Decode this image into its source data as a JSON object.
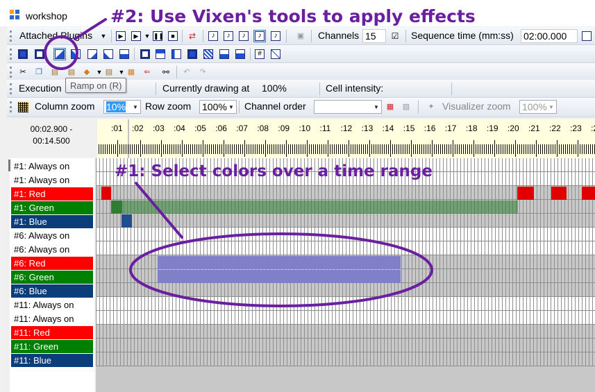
{
  "window": {
    "title": "workshop"
  },
  "toolbar1": {
    "attached_plugins_label": "Attached Plugins",
    "channels_label": "Channels",
    "channels_value": "15",
    "sequence_time_label": "Sequence time (mm:ss)",
    "sequence_time_value": "02:00.000"
  },
  "toolbar3": {
    "execution_label": "Execution",
    "currently_drawing_label": "Currently drawing at",
    "currently_drawing_value": "100%",
    "cell_intensity_label": "Cell intensity:"
  },
  "tooltip": {
    "text": "Ramp on (R)"
  },
  "toolbar4": {
    "column_zoom_label": "Column zoom",
    "column_zoom_value": "10%",
    "row_zoom_label": "Row zoom",
    "row_zoom_value": "100%",
    "channel_order_label": "Channel order",
    "channel_order_value": "",
    "visualizer_zoom_label": "Visualizer zoom",
    "visualizer_zoom_value": "100%"
  },
  "selection": {
    "start": "00:02.900 -",
    "end": "00:14.500"
  },
  "ruler_labels": [
    ":01",
    ":02",
    ":03",
    ":04",
    ":05",
    ":06",
    ":07",
    ":08",
    ":09",
    ":10",
    ":11",
    ":12",
    ":13",
    ":14",
    ":15",
    ":16",
    ":17",
    ":18",
    ":19",
    ":20",
    ":21",
    ":22",
    ":23",
    ":2"
  ],
  "channels": [
    {
      "name": "#1: Always on",
      "color": "#ffffff",
      "text_color": "#000000"
    },
    {
      "name": "#1: Always on",
      "color": "#ffffff",
      "text_color": "#000000"
    },
    {
      "name": "#1: Red",
      "color": "#ff0000",
      "text_color": "#ffffff"
    },
    {
      "name": "#1: Green",
      "color": "#008000",
      "text_color": "#ffffff"
    },
    {
      "name": "#1: Blue",
      "color": "#0b3d7a",
      "text_color": "#ffffff"
    },
    {
      "name": "#6: Always on",
      "color": "#ffffff",
      "text_color": "#000000"
    },
    {
      "name": "#6: Always on",
      "color": "#ffffff",
      "text_color": "#000000"
    },
    {
      "name": "#6: Red",
      "color": "#ff0000",
      "text_color": "#ffffff"
    },
    {
      "name": "#6: Green",
      "color": "#008000",
      "text_color": "#ffffff"
    },
    {
      "name": "#6: Blue",
      "color": "#0b3d7a",
      "text_color": "#ffffff"
    },
    {
      "name": "#11: Always on",
      "color": "#ffffff",
      "text_color": "#000000"
    },
    {
      "name": "#11: Always on",
      "color": "#ffffff",
      "text_color": "#000000"
    },
    {
      "name": "#11: Red",
      "color": "#ff0000",
      "text_color": "#ffffff"
    },
    {
      "name": "#11: Green",
      "color": "#008000",
      "text_color": "#ffffff"
    },
    {
      "name": "#11: Blue",
      "color": "#0b3d7a",
      "text_color": "#ffffff"
    }
  ],
  "annotations": {
    "step2": "#2: Use Vixen's tools to apply effects",
    "step1": "#1: Select colors over a time range",
    "color": "#6a1fa0"
  },
  "colors": {
    "selection": "#8080c8",
    "red_on": "#e00000",
    "green_on": "#2e7d32",
    "blue_on": "#1d4f8f",
    "ruler_bg": "#ffffe0"
  }
}
